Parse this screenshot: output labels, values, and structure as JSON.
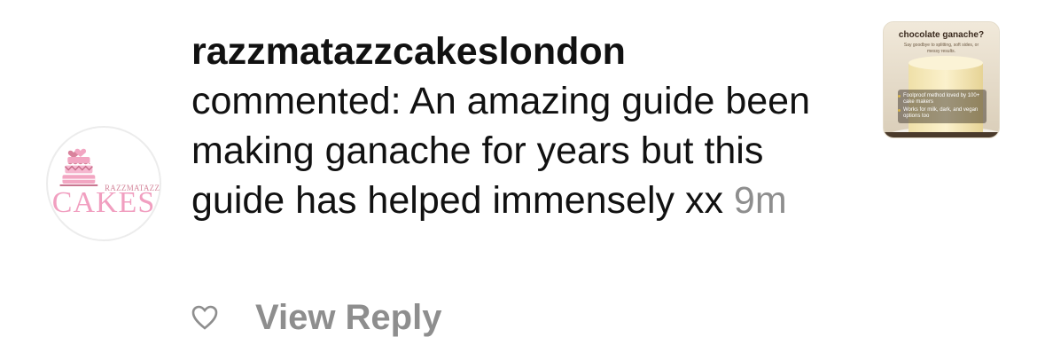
{
  "avatar": {
    "brand_small": "RAZZMATAZZ",
    "brand_big": "CAKES",
    "cake_color": "#f2a6c2",
    "icon": "cake-logo-icon"
  },
  "comment": {
    "username": "razzmatazzcakeslondon",
    "text": "commented: An amazing guide been making ganache for years but this guide has helped immensely xx",
    "time": "9m"
  },
  "thumbnail": {
    "heading": "chocolate ganache?",
    "subheading": "Say goodbye to splitting, soft sides, or messy results.",
    "bullets": [
      "Foolproof method loved by 100+ cake makers",
      "Works for milk, dark, and vegan options too"
    ]
  },
  "reply": {
    "label": "View Reply",
    "icon": "heart-icon"
  },
  "colors": {
    "text": "#111111",
    "muted": "#8e8e8e",
    "brand_pink": "#f19fc0"
  }
}
